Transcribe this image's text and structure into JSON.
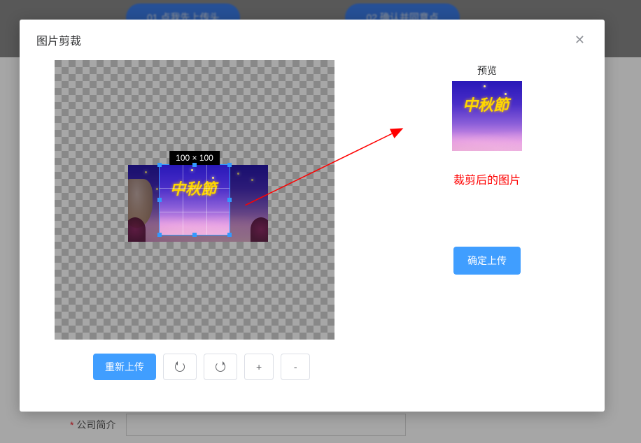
{
  "bg": {
    "button1": "01 点我先上传头",
    "button2": "02 确认并同意点",
    "form_label": "公司简介"
  },
  "modal": {
    "title": "图片剪裁"
  },
  "crop": {
    "size_label": "100 × 100"
  },
  "preview": {
    "label": "预览",
    "annotation": "裁剪后的图片"
  },
  "actions": {
    "confirm_upload": "确定上传",
    "reupload": "重新上传",
    "rotate_ccw": "↺",
    "rotate_cw": "↻",
    "zoom_in": "+",
    "zoom_out": "-"
  },
  "image": {
    "festival_text": "中秋節"
  }
}
